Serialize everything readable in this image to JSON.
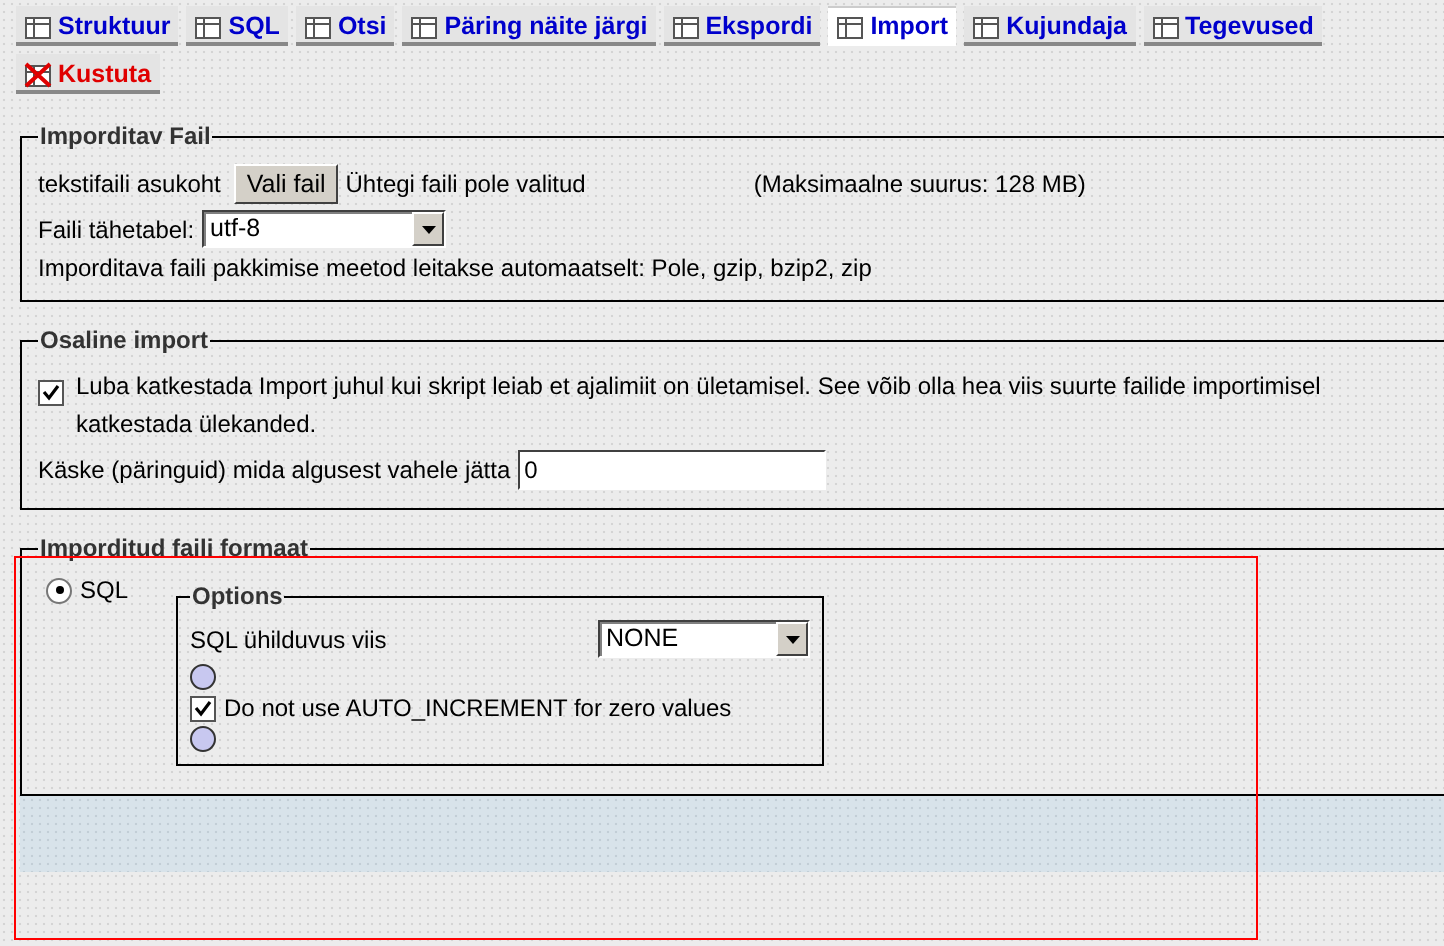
{
  "tabs": [
    {
      "label": "Struktuur",
      "kind": "normal",
      "selected": false
    },
    {
      "label": "SQL",
      "kind": "normal",
      "selected": false
    },
    {
      "label": "Otsi",
      "kind": "normal",
      "selected": false
    },
    {
      "label": "Päring näite järgi",
      "kind": "normal",
      "selected": false
    },
    {
      "label": "Ekspordi",
      "kind": "normal",
      "selected": false
    },
    {
      "label": "Import",
      "kind": "normal",
      "selected": true
    },
    {
      "label": "Kujundaja",
      "kind": "normal",
      "selected": false
    },
    {
      "label": "Tegevused",
      "kind": "normal",
      "selected": false
    },
    {
      "label": "Kustuta",
      "kind": "danger",
      "selected": false
    }
  ],
  "file_section": {
    "legend": "Imporditav Fail",
    "location_label": "tekstifaili asukoht",
    "choose_button": "Vali fail",
    "no_file_text": "Ühtegi faili pole valitud",
    "max_size": "(Maksimaalne suurus: 128 MB)",
    "charset_label": "Faili tähetabel:",
    "charset_value": "utf-8",
    "compression_note": "Imporditava faili pakkimise meetod leitakse automaatselt: Pole, gzip, bzip2, zip"
  },
  "partial_section": {
    "legend": "Osaline import",
    "allow_interrupt": {
      "label": "Luba katkestada Import juhul kui skript leiab et ajalimiit on ületamisel. See võib olla hea viis suurte failide importimisel katkestada ülekanded.",
      "checked": true
    },
    "skip_label": "Käske (päringuid) mida algusest vahele jätta",
    "skip_value": "0"
  },
  "format_section": {
    "legend": "Imporditud faili formaat",
    "formats": [
      {
        "label": "SQL",
        "selected": true
      }
    ],
    "options": {
      "legend": "Options",
      "compat_label": "SQL ühilduvus viis",
      "compat_value": "NONE",
      "no_auto_increment": {
        "label": "Do not use AUTO_INCREMENT for zero values",
        "checked": true
      }
    }
  }
}
